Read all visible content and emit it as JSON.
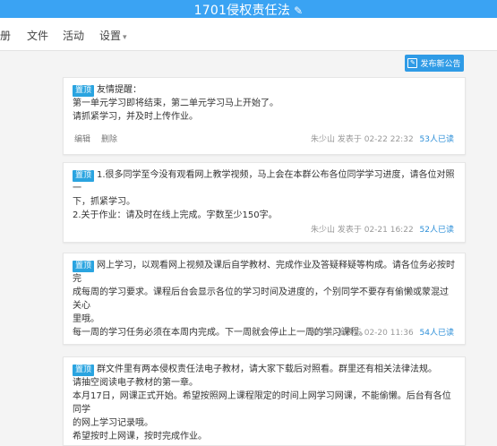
{
  "header": {
    "title": "1701侵权责任法"
  },
  "nav": {
    "items": [
      "册",
      "文件",
      "活动",
      "设置"
    ]
  },
  "toolbar": {
    "publish_label": "发布新公告"
  },
  "pin_label": "置顶",
  "posts": [
    {
      "lines": [
        "友情提醒：",
        "第一单元学习即将结束，第二单元学习马上开始了。",
        "请抓紧学习，并及时上传作业。"
      ],
      "edit": "编辑",
      "delete": "删除",
      "author": "朱少山",
      "posted": "发表于 02-22 22:32",
      "reads": "53人已读"
    },
    {
      "lines": [
        "1.很多同学至今没有观看网上教学视频，马上会在本群公布各位同学学习进度，请各位对照一",
        "下，抓紧学习。",
        "2.关于作业：请及时在线上完成。字数至少150字。"
      ],
      "author": "朱少山",
      "posted": "发表于 02-21 16:22",
      "reads": "52人已读"
    },
    {
      "lines": [
        "网上学习，以观看网上视频及课后自学教材、完成作业及答疑释疑等构成。请各位务必按时完",
        "成每周的学习要求。课程后台会显示各位的学习时间及进度的，个别同学不要存有偷懒或蒙混过关心",
        "里哦。",
        "每一周的学习任务必须在本周内完成。下一周就会停止上一周的学习课程。"
      ],
      "author": "朱少山",
      "posted": "发表于 02-20 11:36",
      "reads": "54人已读"
    },
    {
      "lines": [
        "群文件里有两本侵权责任法电子教材，请大家下载后对照看。群里还有相关法律法规。",
        "请抽空阅读电子教材的第一章。",
        "本月17日，网课正式开始。希望按照网上课程限定的时间上网学习网课，不能偷懒。后台有各位同学",
        "的网上学习记录哦。",
        "希望按时上网课，按时完成作业。"
      ]
    }
  ]
}
